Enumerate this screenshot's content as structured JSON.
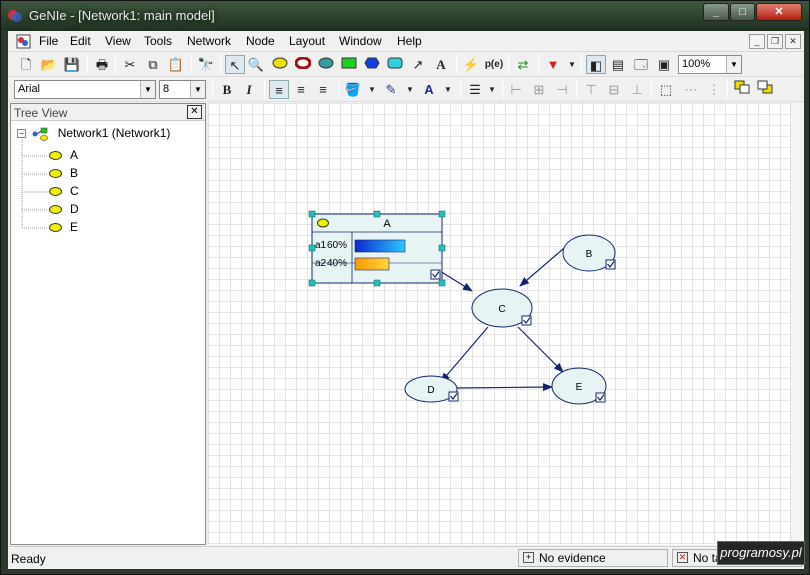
{
  "window": {
    "title": "GeNIe - [Network1: main model]"
  },
  "menu": {
    "items": [
      {
        "label": "File"
      },
      {
        "label": "Edit"
      },
      {
        "label": "View"
      },
      {
        "label": "Tools"
      },
      {
        "label": "Network"
      },
      {
        "label": "Node"
      },
      {
        "label": "Layout"
      },
      {
        "label": "Window"
      },
      {
        "label": "Help"
      }
    ]
  },
  "format_bar": {
    "font_name": "Arial",
    "font_size": "8",
    "bold_label": "B",
    "italic_label": "I"
  },
  "toolbar": {
    "zoom": "100%",
    "text_tool": "A",
    "prob_tool": "p(e)"
  },
  "tree": {
    "header": "Tree View",
    "root_label": "Network1 (Network1)",
    "nodes": [
      {
        "label": "A"
      },
      {
        "label": "B"
      },
      {
        "label": "C"
      },
      {
        "label": "D"
      },
      {
        "label": "E"
      }
    ]
  },
  "network": {
    "expanded_node": {
      "name": "A",
      "states": [
        {
          "label": "a1",
          "percent": "60%",
          "fraction": 0.6,
          "color": "#1f5fe0"
        },
        {
          "label": "a2",
          "percent": "40%",
          "fraction": 0.4,
          "color": "#f59b10"
        }
      ]
    },
    "nodes": [
      {
        "id": "B",
        "label": "B"
      },
      {
        "id": "C",
        "label": "C"
      },
      {
        "id": "D",
        "label": "D"
      },
      {
        "id": "E",
        "label": "E"
      }
    ],
    "arcs": [
      {
        "from": "A",
        "to": "C"
      },
      {
        "from": "B",
        "to": "C"
      },
      {
        "from": "C",
        "to": "D"
      },
      {
        "from": "C",
        "to": "E"
      },
      {
        "from": "D",
        "to": "E"
      }
    ],
    "colors": {
      "node_fill": "#e6f4f4",
      "node_stroke": "#14246e",
      "arc": "#14246e",
      "handle": "#20c0c0"
    }
  },
  "status": {
    "ready": "Ready",
    "evidence": "No evidence",
    "targets": "No targets"
  },
  "watermark": "programosy.pl"
}
